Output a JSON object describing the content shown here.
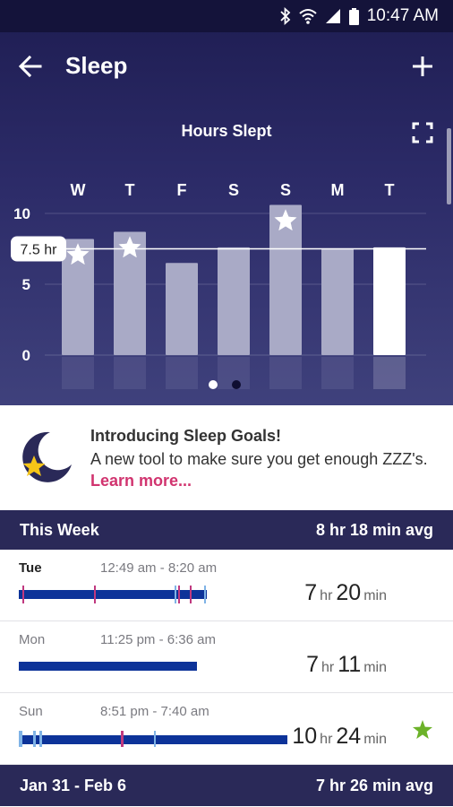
{
  "status_bar": {
    "time": "10:47 AM"
  },
  "app_bar": {
    "title": "Sleep"
  },
  "chart_data": {
    "type": "bar",
    "title": "Hours Slept",
    "categories": [
      "W",
      "T",
      "F",
      "S",
      "S",
      "M",
      "T"
    ],
    "values": [
      8.2,
      8.7,
      6.5,
      7.6,
      10.6,
      7.5,
      7.6
    ],
    "goal_stars": [
      true,
      true,
      false,
      false,
      true,
      false,
      false
    ],
    "highlight_index": 6,
    "ylim": [
      0,
      10
    ],
    "yticks": [
      0,
      5,
      10
    ],
    "goal_line": {
      "value": 7.5,
      "label": "7.5 hr"
    },
    "grid": true,
    "colors": {
      "bar": "#a9aac6",
      "highlight_bar": "#ffffff",
      "background": "#2c2b68"
    }
  },
  "pager": {
    "pages": 2,
    "active": 0
  },
  "promo": {
    "title": "Introducing Sleep Goals!",
    "body": "A new tool to make sure you get enough ZZZ's.",
    "link": "Learn more..."
  },
  "this_week": {
    "label": "This Week",
    "avg": "8 hr 18 min avg",
    "entries": [
      {
        "day": "Tue",
        "time_range": "12:49 am - 8:20 am",
        "hours": "7",
        "hr_unit": "hr",
        "minutes": "20",
        "min_unit": "min",
        "goal_met": false
      },
      {
        "day": "Mon",
        "time_range": "11:25 pm - 6:36 am",
        "hours": "7",
        "hr_unit": "hr",
        "minutes": "11",
        "min_unit": "min",
        "goal_met": false
      },
      {
        "day": "Sun",
        "time_range": "8:51 pm - 7:40 am",
        "hours": "10",
        "hr_unit": "hr",
        "minutes": "24",
        "min_unit": "min",
        "goal_met": true
      }
    ]
  },
  "previous_week": {
    "label": "Jan 31 - Feb 6",
    "avg": "7 hr 26 min avg"
  },
  "colors": {
    "header": "#2a2958",
    "sleep_bar": "#0d3399",
    "awake_mark": "#c0397f",
    "restless_mark": "#7fb3e6",
    "link": "#d1346f",
    "goal_star": "#6cb229"
  }
}
